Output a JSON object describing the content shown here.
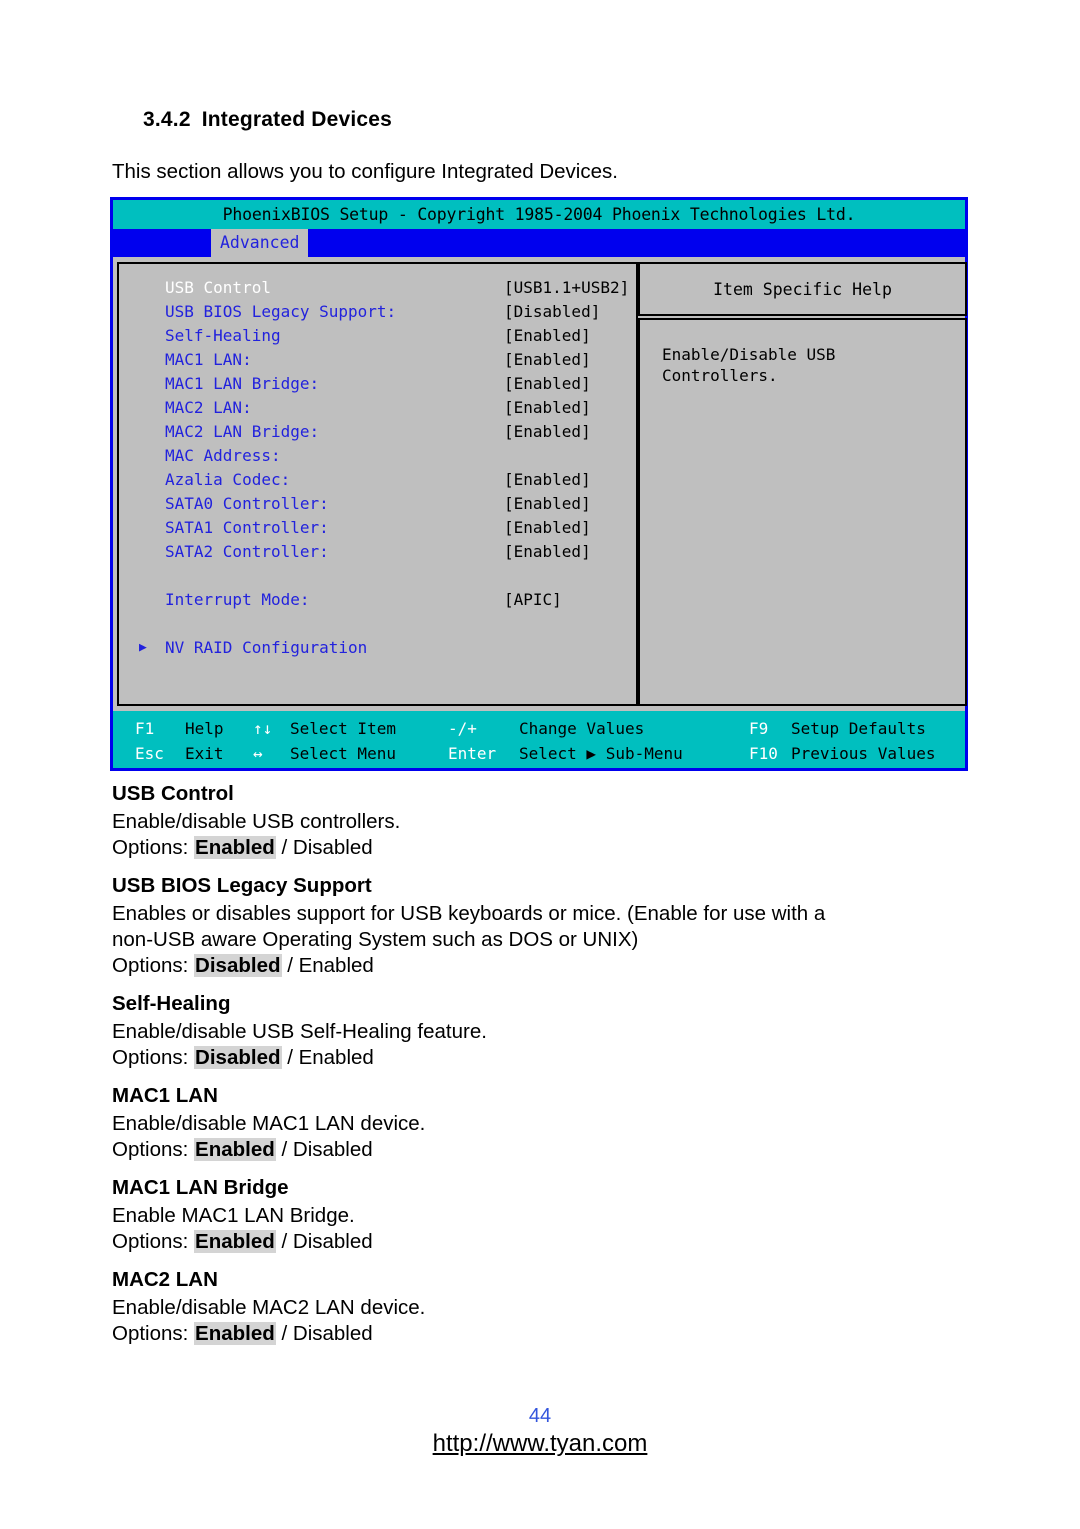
{
  "document": {
    "section_number": "3.4.2",
    "section_title": "Integrated Devices",
    "intro": "This section allows you to configure Integrated Devices."
  },
  "bios": {
    "title_bar": "PhoenixBIOS Setup - Copyright 1985-2004 Phoenix Technologies Ltd.",
    "active_tab": "Advanced",
    "help_title": "Item Specific Help",
    "help_text": "Enable/Disable USB\nControllers.",
    "settings": [
      {
        "label": "USB Control",
        "value": "[USB1.1+USB2]",
        "selected": true,
        "submenu": false
      },
      {
        "label": "USB BIOS Legacy Support:",
        "value": "[Disabled]",
        "selected": false,
        "submenu": false
      },
      {
        "label": "Self-Healing",
        "value": "[Enabled]",
        "selected": false,
        "submenu": false
      },
      {
        "label": "MAC1 LAN:",
        "value": "[Enabled]",
        "selected": false,
        "submenu": false
      },
      {
        "label": "MAC1 LAN Bridge:",
        "value": "[Enabled]",
        "selected": false,
        "submenu": false
      },
      {
        "label": "MAC2 LAN:",
        "value": "[Enabled]",
        "selected": false,
        "submenu": false
      },
      {
        "label": "MAC2 LAN Bridge:",
        "value": "[Enabled]",
        "selected": false,
        "submenu": false
      },
      {
        "label": "MAC Address:",
        "value": "",
        "selected": false,
        "submenu": false
      },
      {
        "label": "Azalia Codec:",
        "value": "[Enabled]",
        "selected": false,
        "submenu": false
      },
      {
        "label": "SATA0 Controller:",
        "value": "[Enabled]",
        "selected": false,
        "submenu": false
      },
      {
        "label": "SATA1 Controller:",
        "value": "[Enabled]",
        "selected": false,
        "submenu": false
      },
      {
        "label": "SATA2 Controller:",
        "value": "[Enabled]",
        "selected": false,
        "submenu": false
      },
      {
        "label": "",
        "value": "",
        "selected": false,
        "submenu": false
      },
      {
        "label": "Interrupt Mode:",
        "value": "[APIC]",
        "selected": false,
        "submenu": false
      },
      {
        "label": "",
        "value": "",
        "selected": false,
        "submenu": false
      },
      {
        "label": "NV RAID Configuration",
        "value": "",
        "selected": false,
        "submenu": true
      }
    ],
    "keybar": {
      "row1": {
        "k1": "F1",
        "d1": "Help",
        "k2": "↑↓",
        "d2": "Select Item",
        "k3": "-/+",
        "d3": "Change Values",
        "k4": "F9",
        "d4": "Setup Defaults"
      },
      "row2": {
        "k1": "Esc",
        "d1": "Exit",
        "k2": "↔",
        "d2": "Select Menu",
        "k3": "Enter",
        "d3": "Select ▶ Sub-Menu",
        "k4": "F10",
        "d4": "Previous Values"
      }
    },
    "colors": {
      "title_bar": "#00bfbf",
      "menu_bar": "#0000ee",
      "panel": "#bfbfbf",
      "label": "#2222dd",
      "selected_label": "#ffffff",
      "border": "#0000ee"
    }
  },
  "options": [
    {
      "title": "USB Control",
      "desc": "Enable/disable USB controllers.",
      "options_prefix": "Options: ",
      "default": "Enabled",
      "alt": " / Disabled",
      "desc2": ""
    },
    {
      "title": "USB BIOS Legacy Support",
      "desc": "Enables or disables support for USB keyboards or mice.  (Enable for use with a",
      "desc2": "non-USB aware Operating System such as DOS or UNIX)",
      "options_prefix": "Options: ",
      "default": "Disabled",
      "alt": " / Enabled"
    },
    {
      "title": "Self-Healing",
      "desc": "Enable/disable USB Self-Healing feature.",
      "desc2": "",
      "options_prefix": "Options: ",
      "default": "Disabled",
      "alt": " / Enabled"
    },
    {
      "title": "MAC1 LAN",
      "desc": "Enable/disable MAC1 LAN device.",
      "desc2": "",
      "options_prefix": "Options: ",
      "default": "Enabled",
      "alt": " / Disabled"
    },
    {
      "title": "MAC1 LAN Bridge",
      "desc": "Enable MAC1 LAN Bridge.",
      "desc2": "",
      "options_prefix": "Options: ",
      "default": "Enabled",
      "alt": " / Disabled"
    },
    {
      "title": "MAC2 LAN",
      "desc": "Enable/disable MAC2 LAN device.",
      "desc2": "",
      "options_prefix": "Options: ",
      "default": "Enabled",
      "alt": " / Disabled"
    }
  ],
  "footer": {
    "page_number": "44",
    "url": "http://www.tyan.com"
  }
}
